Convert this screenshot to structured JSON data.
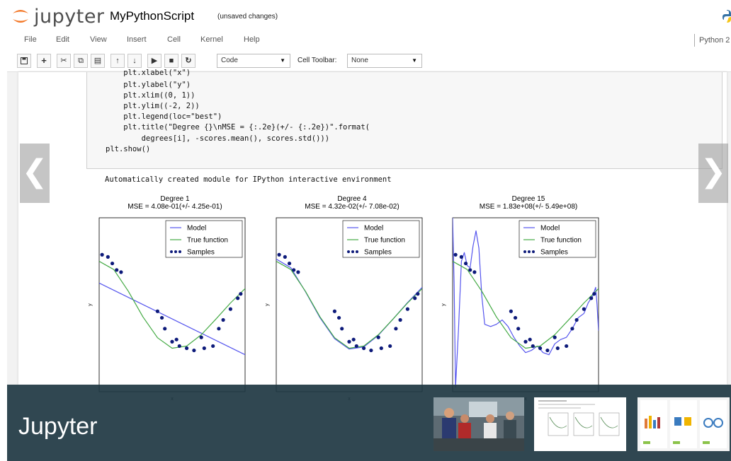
{
  "header": {
    "logo_text": "jupyter",
    "notebook_name": "MyPythonScript",
    "save_status": "(unsaved changes)"
  },
  "menu": {
    "items": [
      "File",
      "Edit",
      "View",
      "Insert",
      "Cell",
      "Kernel",
      "Help"
    ],
    "kernel": "Python 2"
  },
  "toolbar": {
    "cell_type": "Code",
    "cell_toolbar_label": "Cell Toolbar:",
    "cell_toolbar_value": "None",
    "icons": [
      "save-icon",
      "plus-icon",
      "cut-icon",
      "copy-icon",
      "paste-icon",
      "arrow-up-icon",
      "arrow-down-icon",
      "run-icon",
      "stop-icon",
      "restart-icon"
    ]
  },
  "code": {
    "lines": [
      "    plt.xlabel(\"x\")",
      "    plt.ylabel(\"y\")",
      "    plt.xlim((0, 1))",
      "    plt.ylim((-2, 2))",
      "    plt.legend(loc=\"best\")",
      "    plt.title(\"Degree {}\\nMSE = {:.2e}(+/- {:.2e})\".format(",
      "        degrees[i], -scores.mean(), scores.std()))",
      "plt.show()"
    ]
  },
  "output_text": "Automatically created module for IPython interactive environment",
  "legend": [
    "Model",
    "True function",
    "Samples"
  ],
  "colors": {
    "model": "#5555ee",
    "true_function": "#44aa44",
    "samples": "#0d1a7a",
    "overlay": "#1e3742"
  },
  "chart_data": [
    {
      "type": "line",
      "title": "Degree 1\nMSE = 4.08e-01(+/- 4.25e-01)",
      "title_line1": "Degree 1",
      "title_line2": "MSE = 4.08e-01(+/- 4.25e-01)",
      "xlabel": "x",
      "ylabel": "y",
      "xlim": [
        0,
        1
      ],
      "ylim": [
        -2,
        2
      ],
      "legend": "top-right",
      "series": [
        {
          "name": "Model",
          "x": [
            0,
            1
          ],
          "y": [
            0.5,
            -1.15
          ]
        },
        {
          "name": "True function",
          "x": [
            0,
            0.1,
            0.2,
            0.3,
            0.4,
            0.5,
            0.6,
            0.7,
            0.8,
            0.9,
            1.0
          ],
          "y": [
            1,
            0.81,
            0.31,
            -0.28,
            -0.76,
            -1.0,
            -0.95,
            -0.69,
            -0.33,
            0.04,
            0.37
          ]
        },
        {
          "name": "Samples",
          "x": [
            0.02,
            0.06,
            0.09,
            0.12,
            0.15,
            0.4,
            0.43,
            0.45,
            0.5,
            0.53,
            0.55,
            0.6,
            0.65,
            0.7,
            0.72,
            0.78,
            0.82,
            0.85,
            0.9,
            0.95,
            0.97
          ],
          "y": [
            1.15,
            1.1,
            0.95,
            0.8,
            0.75,
            -0.15,
            -0.3,
            -0.55,
            -0.85,
            -0.8,
            -0.95,
            -1.0,
            -1.05,
            -0.75,
            -1.0,
            -0.95,
            -0.55,
            -0.35,
            -0.1,
            0.15,
            0.25
          ]
        }
      ]
    },
    {
      "type": "line",
      "title": "Degree 4\nMSE = 4.32e-02(+/- 7.08e-02)",
      "title_line1": "Degree 4",
      "title_line2": "MSE = 4.32e-02(+/- 7.08e-02)",
      "xlabel": "x",
      "ylabel": "y",
      "xlim": [
        0,
        1
      ],
      "ylim": [
        -2,
        2
      ],
      "legend": "top-right",
      "series": [
        {
          "name": "Model",
          "x": [
            0,
            0.1,
            0.2,
            0.3,
            0.4,
            0.5,
            0.6,
            0.7,
            0.8,
            0.9,
            1.0
          ],
          "y": [
            1.05,
            0.85,
            0.3,
            -0.3,
            -0.78,
            -1.02,
            -0.97,
            -0.7,
            -0.33,
            0.05,
            0.4
          ]
        },
        {
          "name": "True function",
          "x": [
            0,
            0.1,
            0.2,
            0.3,
            0.4,
            0.5,
            0.6,
            0.7,
            0.8,
            0.9,
            1.0
          ],
          "y": [
            1,
            0.81,
            0.31,
            -0.28,
            -0.76,
            -1.0,
            -0.95,
            -0.69,
            -0.33,
            0.04,
            0.37
          ]
        },
        {
          "name": "Samples",
          "x": [
            0.02,
            0.06,
            0.09,
            0.12,
            0.15,
            0.4,
            0.43,
            0.45,
            0.5,
            0.53,
            0.55,
            0.6,
            0.65,
            0.7,
            0.72,
            0.78,
            0.82,
            0.85,
            0.9,
            0.95,
            0.97
          ],
          "y": [
            1.15,
            1.1,
            0.95,
            0.8,
            0.75,
            -0.15,
            -0.3,
            -0.55,
            -0.85,
            -0.8,
            -0.95,
            -1.0,
            -1.05,
            -0.75,
            -1.0,
            -0.95,
            -0.55,
            -0.35,
            -0.1,
            0.15,
            0.25
          ]
        }
      ]
    },
    {
      "type": "line",
      "title": "Degree 15\nMSE = 1.83e+08(+/- 5.49e+08)",
      "title_line1": "Degree 15",
      "title_line2": "MSE = 1.83e+08(+/- 5.49e+08)",
      "xlabel": "x",
      "ylabel": "y",
      "xlim": [
        0,
        1
      ],
      "ylim": [
        -2,
        2
      ],
      "legend": "top-right",
      "series": [
        {
          "name": "Model",
          "x": [
            0,
            0.01,
            0.02,
            0.04,
            0.06,
            0.08,
            0.1,
            0.12,
            0.14,
            0.16,
            0.18,
            0.2,
            0.22,
            0.26,
            0.3,
            0.34,
            0.38,
            0.42,
            0.46,
            0.5,
            0.54,
            0.58,
            0.62,
            0.66,
            0.7,
            0.74,
            0.78,
            0.82,
            0.86,
            0.9,
            0.93,
            0.96,
            0.98,
            0.99,
            1.0
          ],
          "y": [
            2,
            0.5,
            -1.9,
            -0.6,
            1.0,
            1.2,
            0.9,
            0.85,
            1.35,
            1.7,
            1.3,
            0.2,
            -0.45,
            -0.5,
            -0.45,
            -0.35,
            -0.5,
            -0.75,
            -0.95,
            -1.1,
            -1.05,
            -0.95,
            -1.1,
            -1.15,
            -0.9,
            -0.8,
            -0.75,
            -0.55,
            -0.3,
            -0.2,
            0.05,
            0.2,
            0.4,
            0.0,
            -0.6
          ]
        },
        {
          "name": "True function",
          "x": [
            0,
            0.1,
            0.2,
            0.3,
            0.4,
            0.5,
            0.6,
            0.7,
            0.8,
            0.9,
            1.0
          ],
          "y": [
            1,
            0.81,
            0.31,
            -0.28,
            -0.76,
            -1.0,
            -0.95,
            -0.69,
            -0.33,
            0.04,
            0.37
          ]
        },
        {
          "name": "Samples",
          "x": [
            0.02,
            0.06,
            0.09,
            0.12,
            0.15,
            0.4,
            0.43,
            0.45,
            0.5,
            0.53,
            0.55,
            0.6,
            0.65,
            0.7,
            0.72,
            0.78,
            0.82,
            0.85,
            0.9,
            0.95,
            0.97
          ],
          "y": [
            1.15,
            1.1,
            0.95,
            0.8,
            0.75,
            -0.15,
            -0.3,
            -0.55,
            -0.85,
            -0.8,
            -0.95,
            -1.0,
            -1.05,
            -0.75,
            -1.0,
            -0.95,
            -0.55,
            -0.35,
            -0.1,
            0.15,
            0.25
          ]
        }
      ]
    }
  ],
  "overlay": {
    "title": "Jupyter"
  }
}
